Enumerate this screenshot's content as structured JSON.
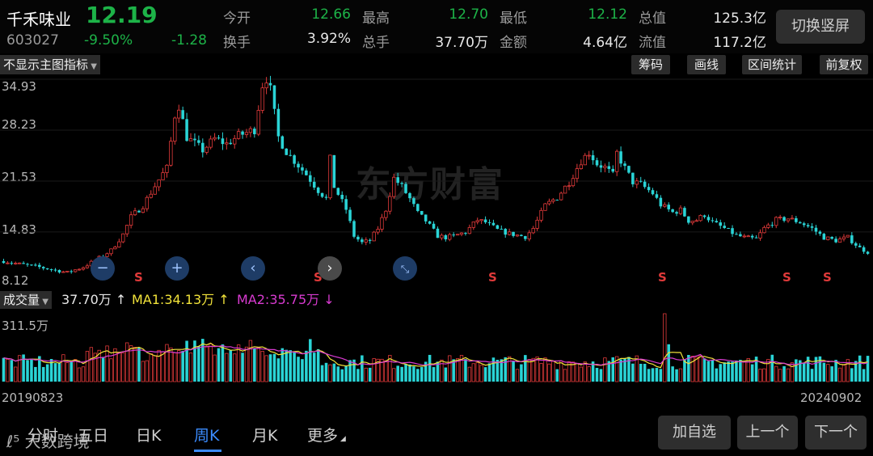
{
  "quote": {
    "name": "千禾味业",
    "price": "12.19",
    "code": "603027",
    "change_pct": "-9.50%",
    "change": "-1.28",
    "open_label": "今开",
    "open": "12.66",
    "high_label": "最高",
    "high": "12.70",
    "low_label": "最低",
    "low": "12.12",
    "mktcap_label": "总值",
    "mktcap": "125.3亿",
    "turnover_label": "换手",
    "turnover": "3.92%",
    "vol_label": "总手",
    "vol": "37.70万",
    "amount_label": "金额",
    "amount": "4.64亿",
    "float_label": "流值",
    "float": "117.2亿",
    "switch_label": "切换竖屏"
  },
  "toolbar": {
    "indicator": "不显示主图指标",
    "chips": "筹码",
    "draw": "画线",
    "range": "区间统计",
    "adjust": "前复权"
  },
  "watermark": "东方财富",
  "nav_icons": [
    "minus-icon",
    "plus-icon",
    "chevron-left-icon",
    "chevron-right-icon",
    "compress-icon"
  ],
  "colors": {
    "up": "#e03a3a",
    "down": "#2ad4d6",
    "ma1": "#f2e33a",
    "ma2": "#d93bd1",
    "accent": "#3b8cff"
  },
  "volume_panel": {
    "selector": "成交量",
    "vol": "37.70万 ↑",
    "ma1": "MA1:34.13万 ↑",
    "ma2": "MA2:35.75万 ↓",
    "max_label": "311.5万"
  },
  "dates": {
    "start": "20190823",
    "end": "20240902"
  },
  "tabs": [
    "分时",
    "五日",
    "日K",
    "周K",
    "月K",
    "更多"
  ],
  "active_tab": "周K",
  "buttons": {
    "add_watch": "加自选",
    "prev": "上一个",
    "next": "下一个"
  },
  "logo_text": "大数跨境",
  "chart_data": {
    "type": "candlestick",
    "period": "weekly",
    "price_axis_ticks": [
      34.93,
      28.23,
      21.53,
      14.83,
      8.12
    ],
    "ylim": [
      8.12,
      34.93
    ],
    "sell_signals": [
      "S",
      "S",
      "S",
      "S",
      "S",
      "S"
    ],
    "close_series": [
      [
        0,
        11
      ],
      [
        4,
        10.6
      ],
      [
        8,
        10.3
      ],
      [
        12,
        9.9
      ],
      [
        16,
        9.5
      ],
      [
        20,
        10.2
      ],
      [
        24,
        11.4
      ],
      [
        27,
        12.4
      ],
      [
        30,
        14.5
      ],
      [
        32,
        16.8
      ],
      [
        35,
        18.3
      ],
      [
        38,
        20.9
      ],
      [
        40,
        22.5
      ],
      [
        41,
        23.2
      ],
      [
        43,
        30.2
      ],
      [
        44,
        31.5
      ],
      [
        46,
        27.3
      ],
      [
        50,
        25.6
      ],
      [
        53,
        27.1
      ],
      [
        56,
        26.4
      ],
      [
        59,
        27.5
      ],
      [
        63,
        28.3
      ],
      [
        65,
        34.2
      ],
      [
        66,
        35.1
      ],
      [
        67,
        33.5
      ],
      [
        69,
        27.3
      ],
      [
        71,
        25.4
      ],
      [
        73,
        24.2
      ],
      [
        76,
        22.4
      ],
      [
        79,
        20.3
      ],
      [
        81,
        19.2
      ],
      [
        82,
        24.4
      ],
      [
        83,
        20.8
      ],
      [
        86,
        17.8
      ],
      [
        88,
        14.3
      ],
      [
        90,
        13.4
      ],
      [
        92,
        13.7
      ],
      [
        94,
        15.3
      ],
      [
        96,
        17.8
      ],
      [
        98,
        21.9
      ],
      [
        100,
        20.8
      ],
      [
        102,
        19.2
      ],
      [
        104,
        17.3
      ],
      [
        106,
        16.3
      ],
      [
        109,
        14.3
      ],
      [
        111,
        14.1
      ],
      [
        113,
        14.3
      ],
      [
        116,
        14.8
      ],
      [
        119,
        16.4
      ],
      [
        121,
        16.1
      ],
      [
        124,
        15.1
      ],
      [
        127,
        14.6
      ],
      [
        130,
        14.3
      ],
      [
        131,
        14.2
      ],
      [
        133,
        15.3
      ],
      [
        136,
        18.3
      ],
      [
        139,
        19.4
      ],
      [
        142,
        21.4
      ],
      [
        145,
        24.2
      ],
      [
        147,
        25.3
      ],
      [
        149,
        23.8
      ],
      [
        151,
        23.3
      ],
      [
        153,
        22.3
      ],
      [
        154,
        25.2
      ],
      [
        156,
        23.2
      ],
      [
        158,
        21.4
      ],
      [
        160,
        21.1
      ],
      [
        163,
        19.9
      ],
      [
        165,
        18.4
      ],
      [
        168,
        17.4
      ],
      [
        170,
        17.7
      ],
      [
        172,
        16.3
      ],
      [
        174,
        16.4
      ],
      [
        176,
        17.1
      ],
      [
        178,
        16.1
      ],
      [
        181,
        15.3
      ],
      [
        184,
        14.4
      ],
      [
        186,
        14.1
      ],
      [
        189,
        13.9
      ],
      [
        191,
        15.3
      ],
      [
        194,
        16.4
      ],
      [
        197,
        16.6
      ],
      [
        200,
        16.1
      ],
      [
        203,
        15.3
      ],
      [
        206,
        14.1
      ],
      [
        209,
        13.7
      ],
      [
        212,
        14.1
      ],
      [
        215,
        12.7
      ],
      [
        217,
        12.19
      ]
    ],
    "volume_max": "311.5万"
  }
}
